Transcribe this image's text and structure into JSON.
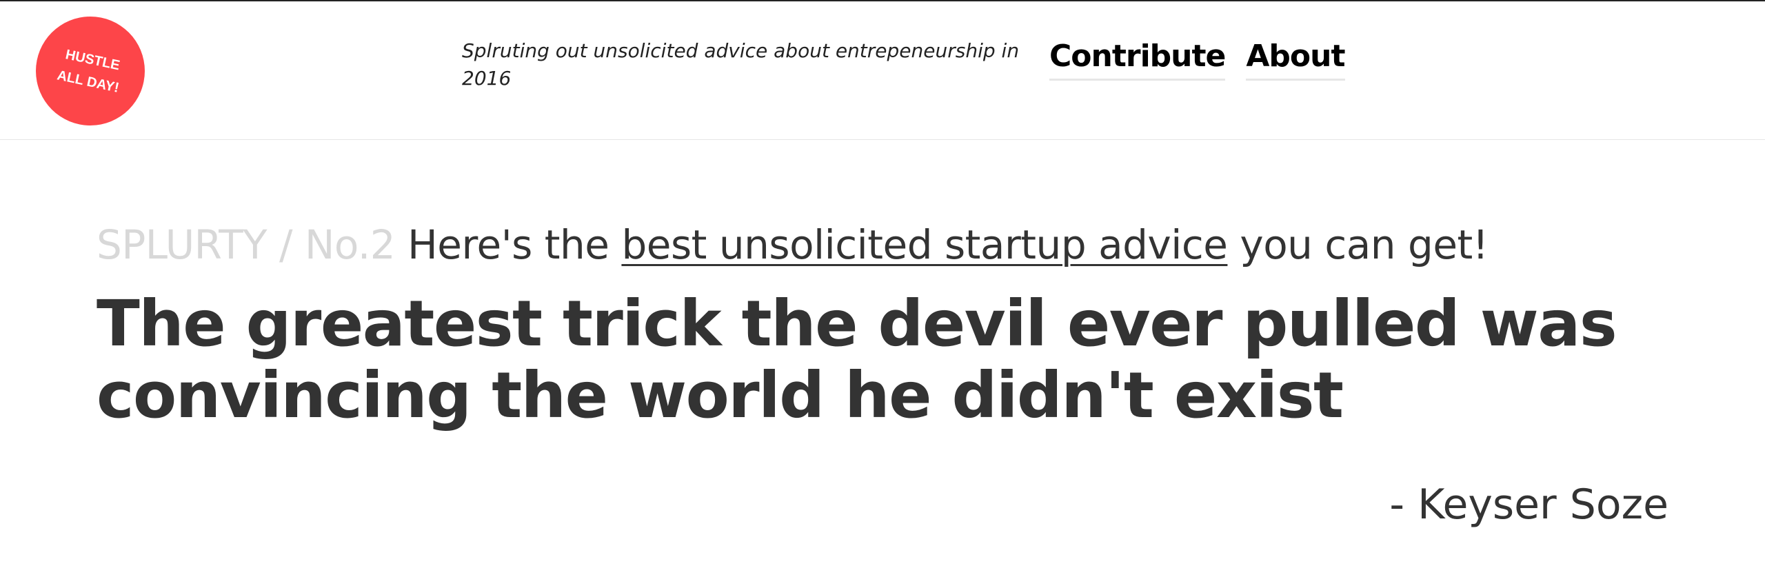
{
  "header": {
    "logo_text": "HUSTLE ALL DAY!",
    "tagline": "Splruting out unsolicited advice about entrepeneurship in 2016",
    "nav": [
      {
        "label": "Contribute"
      },
      {
        "label": "About"
      }
    ]
  },
  "main": {
    "series_label": "SPLURTY / No.2",
    "kicker_prefix": "Here's the",
    "kicker_link": "best unsolicited startup advice",
    "kicker_suffix": "you can get!",
    "quote": "The greatest trick the devil ever pulled was convincing the world he didn't exist",
    "author": "- Keyser Soze"
  },
  "colors": {
    "logo_background": "#fd4549",
    "text": "#333333",
    "muted_text": "#d8d8d8",
    "nav_underline": "#e6e6e6"
  }
}
